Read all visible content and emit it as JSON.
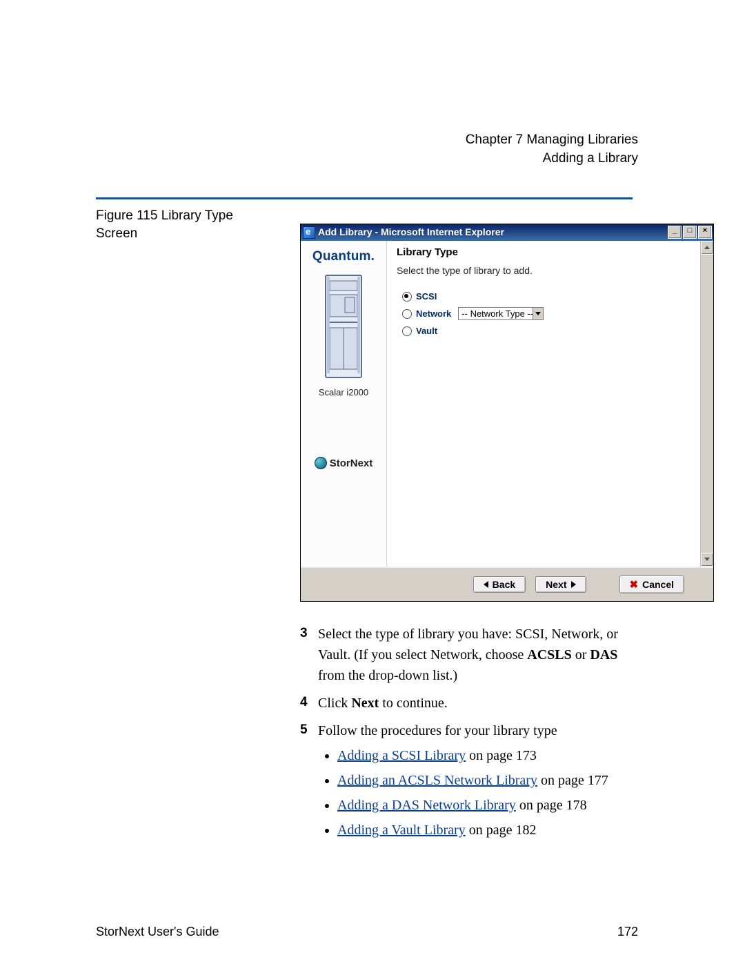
{
  "header": {
    "chapter": "Chapter 7  Managing Libraries",
    "section": "Adding a Library"
  },
  "figure_caption": "Figure 115  Library Type Screen",
  "window": {
    "title": "Add Library - Microsoft Internet Explorer",
    "buttons": {
      "min": "_",
      "max": "□",
      "close": "×"
    },
    "sidebar": {
      "brand": "Quantum.",
      "model": "Scalar i2000",
      "product": "StorNext"
    },
    "content": {
      "title": "Library Type",
      "subtitle": "Select the type of library to add.",
      "options": {
        "scsi": "SCSI",
        "network": "Network",
        "network_select": "-- Network Type --",
        "vault": "Vault"
      }
    },
    "nav": {
      "back": "Back",
      "next": "Next",
      "cancel": "Cancel"
    }
  },
  "steps": {
    "s3": {
      "num": "3",
      "t1": "Select the type of library you have: SCSI, Network, or Vault. (If you select Network, choose ",
      "b1": "ACSLS",
      "t2": " or ",
      "b2": "DAS",
      "t3": " from the drop-down list.)"
    },
    "s4": {
      "num": "4",
      "t1": "Click ",
      "b1": "Next",
      "t2": " to continue."
    },
    "s5": {
      "num": "5",
      "t1": "Follow the procedures for your library type",
      "links": [
        {
          "text": "Adding a SCSI Library",
          "tail": " on page  173"
        },
        {
          "text": "Adding an ACSLS Network Library",
          "tail": " on page  177"
        },
        {
          "text": "Adding a DAS Network Library",
          "tail": " on page  178"
        },
        {
          "text": "Adding a Vault Library",
          "tail": " on page  182"
        }
      ]
    }
  },
  "footer": {
    "left": "StorNext User's Guide",
    "right": "172"
  }
}
